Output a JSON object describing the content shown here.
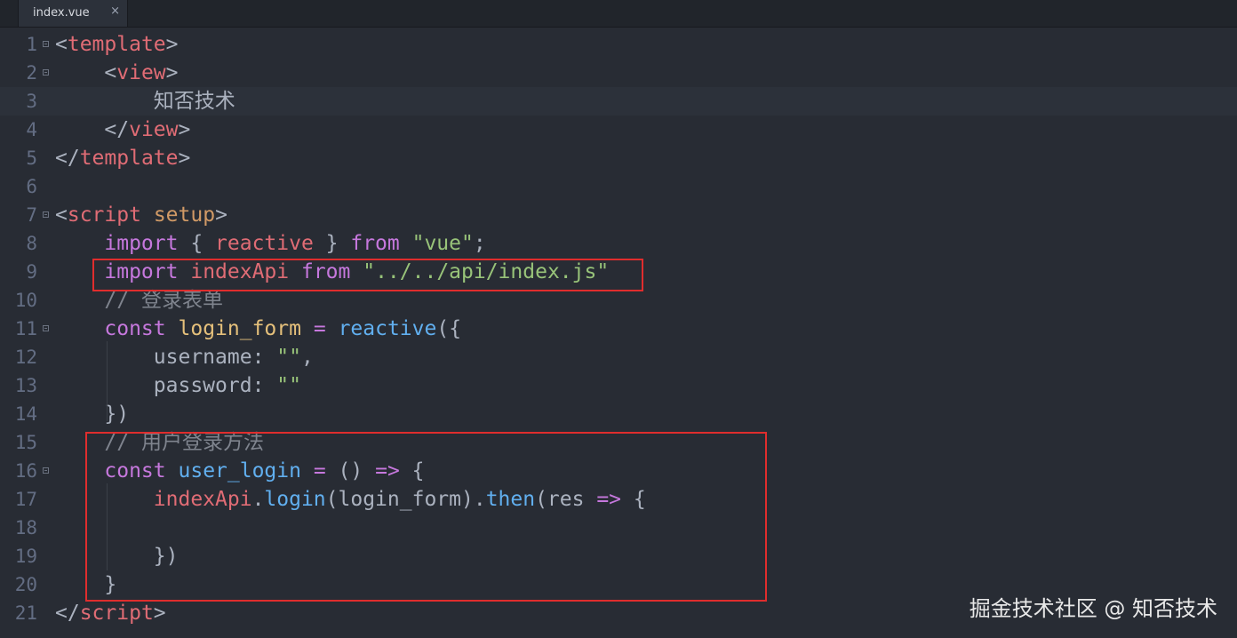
{
  "tab": {
    "label": "index.vue",
    "close_glyph": "×"
  },
  "lines": [
    {
      "n": "1",
      "fold": true,
      "tokens": [
        {
          "c": "t-punct",
          "t": "<"
        },
        {
          "c": "t-tag",
          "t": "template"
        },
        {
          "c": "t-punct",
          "t": ">"
        }
      ]
    },
    {
      "n": "2",
      "fold": true,
      "tokens": [
        {
          "c": "t-plain",
          "t": "    "
        },
        {
          "c": "t-punct",
          "t": "<"
        },
        {
          "c": "t-tag",
          "t": "view"
        },
        {
          "c": "t-punct",
          "t": ">"
        }
      ]
    },
    {
      "n": "3",
      "fold": false,
      "active": true,
      "tokens": [
        {
          "c": "t-plain",
          "t": "        "
        },
        {
          "c": "t-plain cjk",
          "t": "知否技术"
        }
      ]
    },
    {
      "n": "4",
      "fold": false,
      "tokens": [
        {
          "c": "t-plain",
          "t": "    "
        },
        {
          "c": "t-punct",
          "t": "</"
        },
        {
          "c": "t-tag",
          "t": "view"
        },
        {
          "c": "t-punct",
          "t": ">"
        }
      ]
    },
    {
      "n": "5",
      "fold": false,
      "tokens": [
        {
          "c": "t-punct",
          "t": "</"
        },
        {
          "c": "t-tag",
          "t": "template"
        },
        {
          "c": "t-punct",
          "t": ">"
        }
      ]
    },
    {
      "n": "6",
      "fold": false,
      "tokens": []
    },
    {
      "n": "7",
      "fold": true,
      "tokens": [
        {
          "c": "t-punct",
          "t": "<"
        },
        {
          "c": "t-tag",
          "t": "script"
        },
        {
          "c": "t-plain",
          "t": " "
        },
        {
          "c": "t-attr",
          "t": "setup"
        },
        {
          "c": "t-punct",
          "t": ">"
        }
      ]
    },
    {
      "n": "8",
      "fold": false,
      "tokens": [
        {
          "c": "t-plain",
          "t": "    "
        },
        {
          "c": "t-kw",
          "t": "import"
        },
        {
          "c": "t-plain",
          "t": " { "
        },
        {
          "c": "t-var",
          "t": "reactive"
        },
        {
          "c": "t-plain",
          "t": " } "
        },
        {
          "c": "t-kw",
          "t": "from"
        },
        {
          "c": "t-plain",
          "t": " "
        },
        {
          "c": "t-str",
          "t": "\"vue\""
        },
        {
          "c": "t-plain",
          "t": ";"
        }
      ]
    },
    {
      "n": "9",
      "fold": false,
      "tokens": [
        {
          "c": "t-plain",
          "t": "    "
        },
        {
          "c": "t-kw",
          "t": "import"
        },
        {
          "c": "t-plain",
          "t": " "
        },
        {
          "c": "t-var",
          "t": "indexApi"
        },
        {
          "c": "t-plain",
          "t": " "
        },
        {
          "c": "t-kw",
          "t": "from"
        },
        {
          "c": "t-plain",
          "t": " "
        },
        {
          "c": "t-str",
          "t": "\"../../api/index.js\""
        }
      ]
    },
    {
      "n": "10",
      "fold": false,
      "tokens": [
        {
          "c": "t-plain",
          "t": "    "
        },
        {
          "c": "t-comment",
          "t": "// "
        },
        {
          "c": "t-comment cjk",
          "t": "登录表单"
        }
      ]
    },
    {
      "n": "11",
      "fold": true,
      "tokens": [
        {
          "c": "t-plain",
          "t": "    "
        },
        {
          "c": "t-kw",
          "t": "const"
        },
        {
          "c": "t-plain",
          "t": " "
        },
        {
          "c": "t-decl",
          "t": "login_form"
        },
        {
          "c": "t-plain",
          "t": " "
        },
        {
          "c": "t-op",
          "t": "="
        },
        {
          "c": "t-plain",
          "t": " "
        },
        {
          "c": "t-fn",
          "t": "reactive"
        },
        {
          "c": "t-plain",
          "t": "({"
        }
      ]
    },
    {
      "n": "12",
      "fold": false,
      "tokens": [
        {
          "c": "t-plain",
          "t": "        "
        },
        {
          "c": "t-prop",
          "t": "username"
        },
        {
          "c": "t-plain",
          "t": ": "
        },
        {
          "c": "t-str",
          "t": "\"\""
        },
        {
          "c": "t-plain",
          "t": ","
        }
      ]
    },
    {
      "n": "13",
      "fold": false,
      "tokens": [
        {
          "c": "t-plain",
          "t": "        "
        },
        {
          "c": "t-prop",
          "t": "password"
        },
        {
          "c": "t-plain",
          "t": ": "
        },
        {
          "c": "t-str",
          "t": "\"\""
        }
      ]
    },
    {
      "n": "14",
      "fold": false,
      "tokens": [
        {
          "c": "t-plain",
          "t": "    "
        },
        {
          "c": "t-plain",
          "t": "})"
        }
      ]
    },
    {
      "n": "15",
      "fold": false,
      "tokens": [
        {
          "c": "t-plain",
          "t": "    "
        },
        {
          "c": "t-comment",
          "t": "// "
        },
        {
          "c": "t-comment cjk",
          "t": "用户登录方法"
        }
      ]
    },
    {
      "n": "16",
      "fold": true,
      "tokens": [
        {
          "c": "t-plain",
          "t": "    "
        },
        {
          "c": "t-kw",
          "t": "const"
        },
        {
          "c": "t-plain",
          "t": " "
        },
        {
          "c": "t-fn",
          "t": "user_login"
        },
        {
          "c": "t-plain",
          "t": " "
        },
        {
          "c": "t-op",
          "t": "="
        },
        {
          "c": "t-plain",
          "t": " () "
        },
        {
          "c": "t-op",
          "t": "=>"
        },
        {
          "c": "t-plain",
          "t": " {"
        }
      ]
    },
    {
      "n": "17",
      "fold": false,
      "tokens": [
        {
          "c": "t-plain",
          "t": "        "
        },
        {
          "c": "t-var",
          "t": "indexApi"
        },
        {
          "c": "t-plain",
          "t": "."
        },
        {
          "c": "t-fn",
          "t": "login"
        },
        {
          "c": "t-plain",
          "t": "(login_form)."
        },
        {
          "c": "t-fn",
          "t": "then"
        },
        {
          "c": "t-plain",
          "t": "(res "
        },
        {
          "c": "t-op",
          "t": "=>"
        },
        {
          "c": "t-plain",
          "t": " {"
        }
      ]
    },
    {
      "n": "18",
      "fold": false,
      "tokens": []
    },
    {
      "n": "19",
      "fold": false,
      "tokens": [
        {
          "c": "t-plain",
          "t": "        "
        },
        {
          "c": "t-plain",
          "t": "})"
        }
      ]
    },
    {
      "n": "20",
      "fold": false,
      "tokens": [
        {
          "c": "t-plain",
          "t": "    "
        },
        {
          "c": "t-plain",
          "t": "}"
        }
      ]
    },
    {
      "n": "21",
      "fold": false,
      "tokens": [
        {
          "c": "t-punct",
          "t": "</"
        },
        {
          "c": "t-tag",
          "t": "script"
        },
        {
          "c": "t-punct",
          "t": ">"
        }
      ]
    }
  ],
  "watermark": "掘金技术社区 @ 知否技术",
  "colors": {
    "background": "#282c34",
    "highlight_box": "#e02d2d"
  }
}
